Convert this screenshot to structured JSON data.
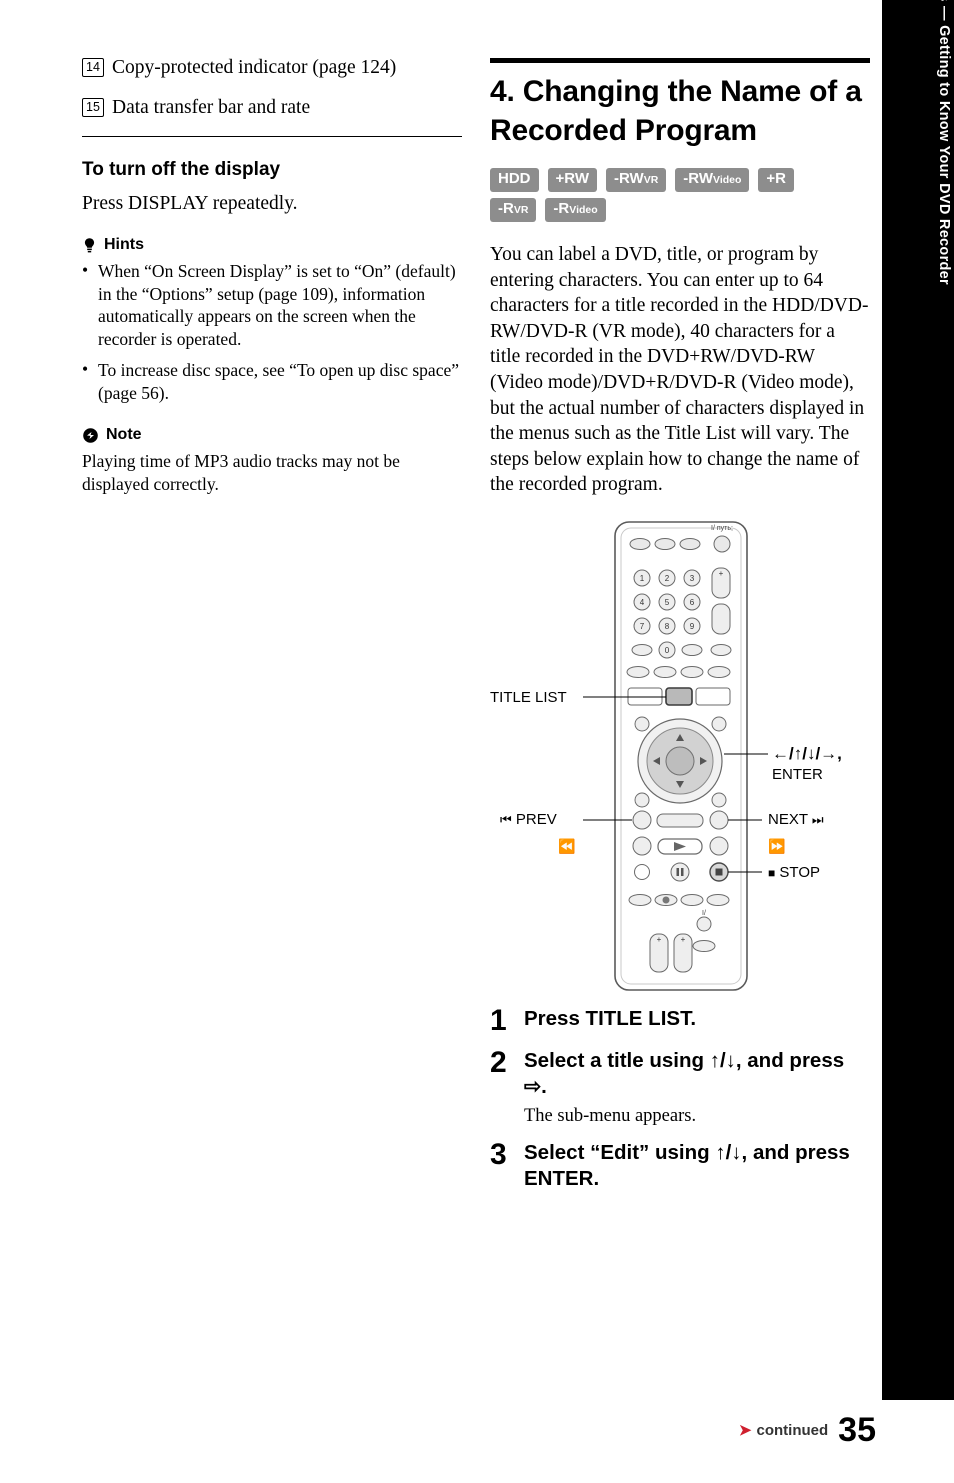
{
  "left": {
    "numbered_items": [
      {
        "num": "14",
        "text": "Copy-protected indicator (page 124)"
      },
      {
        "num": "15",
        "text": "Data transfer bar and rate"
      }
    ],
    "turn_off_heading": "To turn off the display",
    "turn_off_body": "Press DISPLAY repeatedly.",
    "hints_label": "Hints",
    "hints": [
      "When “On Screen Display” is set to “On” (default) in the “Options” setup (page 109), information automatically appears on the screen when the recorder is operated.",
      "To increase disc space, see “To open up disc space” (page 56)."
    ],
    "note_label": "Note",
    "note_body": "Playing time of MP3 audio tracks may not be displayed correctly."
  },
  "right": {
    "section_title": "4. Changing the Name of a Recorded Program",
    "badges": [
      {
        "main": "HDD",
        "sub": ""
      },
      {
        "main": "+RW",
        "sub": ""
      },
      {
        "main": "-RW",
        "sub": "VR"
      },
      {
        "main": "-RW",
        "sub": "Video"
      },
      {
        "main": "+R",
        "sub": ""
      },
      {
        "main": "-R",
        "sub": "VR"
      },
      {
        "main": "-R",
        "sub": "Video"
      }
    ],
    "intro": "You can label a DVD, title, or program by entering characters. You can enter up to 64 characters for a title recorded in the HDD/DVD-RW/DVD-R (VR mode), 40 characters for a title recorded in the DVD+RW/DVD-RW (Video mode)/DVD+R/DVD-R (Video mode), but the actual number of characters displayed in the menus such as the Title List will vary. The steps below explain how to change the name of the recorded program.",
    "callouts": {
      "title_list": "TITLE LIST",
      "dpad": "←/↑/↓/→,",
      "enter": "ENTER",
      "prev": "PREV",
      "next": "NEXT",
      "stop": "STOP"
    },
    "steps": [
      {
        "num": "1",
        "title": "Press TITLE LIST.",
        "sub": ""
      },
      {
        "num": "2",
        "title": "Select a title using ↑/↓, and press ⇨.",
        "sub": "The sub-menu appears."
      },
      {
        "num": "3",
        "title": "Select “Edit” using ↑/↓, and press ENTER.",
        "sub": ""
      }
    ]
  },
  "side_tab": "Seven Basic Operations — Getting to Know Your DVD Recorder",
  "footer": {
    "continued": "continued",
    "page_number": "35"
  },
  "colors": {
    "badge_bg": "#8d8d8d",
    "accent_red": "#cf1f2e",
    "tab_bg": "#000000"
  }
}
